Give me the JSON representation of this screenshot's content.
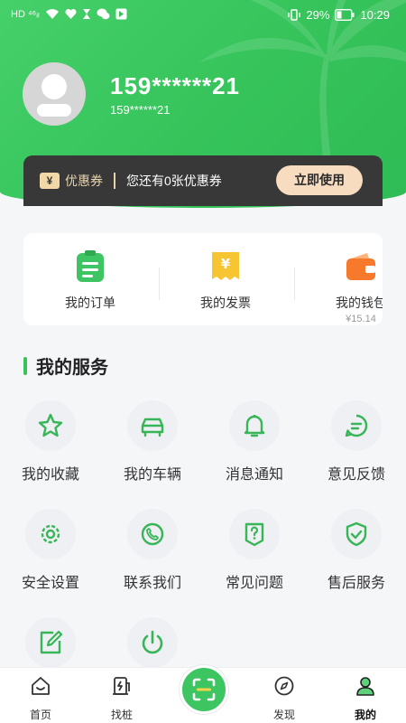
{
  "status_bar": {
    "left_text": "HD ⁴⁶ᵢₗ",
    "battery": "29%",
    "time": "10:29"
  },
  "profile": {
    "phone_masked": "159******21",
    "phone_sub": "159******21"
  },
  "coupon": {
    "tag_icon": "¥",
    "label": "优惠券",
    "text": "您还有0张优惠券",
    "button": "立即使用"
  },
  "quick": {
    "items": [
      {
        "label": "我的订单",
        "icon": "order-icon"
      },
      {
        "label": "我的发票",
        "icon": "invoice-icon"
      },
      {
        "label": "我的钱包",
        "icon": "wallet-icon",
        "sub": "¥15.14"
      }
    ]
  },
  "services": {
    "title": "我的服务",
    "items": [
      {
        "label": "我的收藏",
        "icon": "star-icon"
      },
      {
        "label": "我的车辆",
        "icon": "car-icon"
      },
      {
        "label": "消息通知",
        "icon": "bell-icon"
      },
      {
        "label": "意见反馈",
        "icon": "chat-icon"
      },
      {
        "label": "安全设置",
        "icon": "gear-icon"
      },
      {
        "label": "联系我们",
        "icon": "phone-icon"
      },
      {
        "label": "常见问题",
        "icon": "question-icon"
      },
      {
        "label": "售后服务",
        "icon": "shield-icon"
      },
      {
        "label": "",
        "icon": "edit-icon"
      },
      {
        "label": "",
        "icon": "power-icon"
      }
    ]
  },
  "nav": {
    "items": [
      {
        "label": "首页",
        "icon": "home-icon"
      },
      {
        "label": "找桩",
        "icon": "charging-pile-icon"
      },
      {
        "label": "发现",
        "icon": "compass-icon"
      },
      {
        "label": "我的",
        "icon": "user-icon"
      }
    ],
    "active": "我的"
  },
  "colors": {
    "brand_green": "#37c25a",
    "coupon_bg": "#383838",
    "coupon_btn": "#f7dcc0"
  }
}
